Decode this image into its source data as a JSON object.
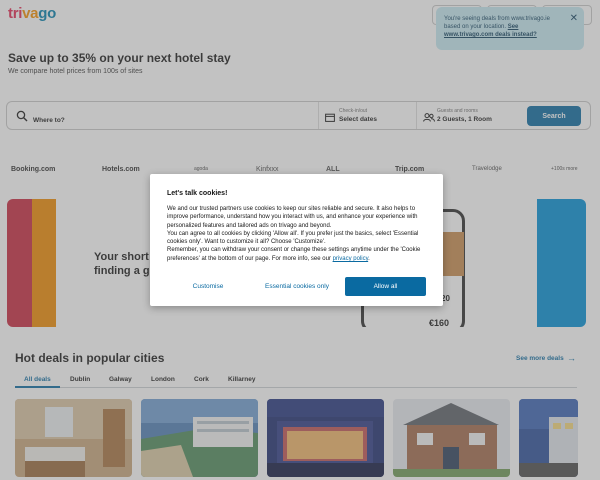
{
  "brand": {
    "logo_parts": [
      "tri",
      "va",
      "go"
    ],
    "colors": {
      "red": "#e32851",
      "orange": "#f48f00",
      "blue": "#007fad",
      "accent": "#0a6aa1"
    }
  },
  "toast": {
    "text": "You're seeing deals from www.trivago.ie based on your location.",
    "link": "See www.trivago.com deals instead?",
    "close_icon": "close-icon"
  },
  "hero": {
    "title": "Save up to 35% on your next hotel stay",
    "subtitle": "We compare hotel prices from 100s of sites"
  },
  "search": {
    "destination_placeholder": "Where to?",
    "dates_label": "Check-in/out",
    "dates_value": "Select dates",
    "guests_label": "Guests and rooms",
    "guests_value": "2 Guests, 1 Room",
    "button": "Search"
  },
  "partners": [
    "Booking.com",
    "Hotels.com",
    "agoda",
    "Kinfxxx",
    "ALL",
    "Trip.com",
    "Travelodge",
    "+100s more"
  ],
  "promo": {
    "headline_line1": "Your short",
    "headline_line2": "finding a g",
    "price_1": "20",
    "price_2": "€160"
  },
  "cookie_modal": {
    "title": "Let's talk cookies!",
    "body_p1": "We and our trusted partners use cookies to keep our sites reliable and secure. It also helps to improve performance, understand how you interact with us, and enhance your experience with personalized features and tailored ads on trivago and beyond.",
    "body_p2": "You can agree to all cookies by clicking 'Allow all'. If you prefer just the basics, select 'Essential cookies only'. Want to customize it all? Choose 'Customize'.",
    "body_p3": "Remember, you can withdraw your consent or change these settings anytime under the 'Cookie preferences' at the bottom of our page. For more info, see our",
    "privacy_link": "privacy policy",
    "period": ".",
    "btn_customise": "Customise",
    "btn_essential": "Essential cookies only",
    "btn_allow": "Allow all"
  },
  "hot_deals": {
    "title": "Hot deals in popular cities",
    "see_more": "See more deals",
    "tabs": [
      "All deals",
      "Dublin",
      "Galway",
      "London",
      "Cork",
      "Killarney"
    ],
    "active_tab": "All deals"
  }
}
